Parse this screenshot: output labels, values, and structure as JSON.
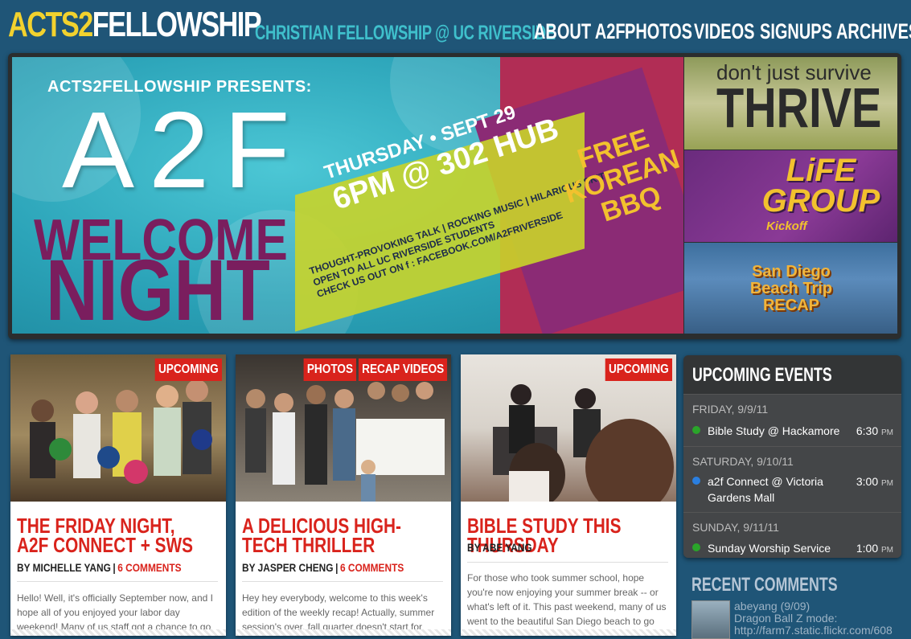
{
  "header": {
    "logo_part1": "ACTS2",
    "logo_part2": "FELLOWSHIP",
    "tagline": "CHRISTIAN FELLOWSHIP @ UC RIVERSIDE",
    "nav": [
      "ABOUT A2F",
      "PHOTOS",
      "VIDEOS",
      "SIGNUPS",
      "ARCHIVES"
    ]
  },
  "hero": {
    "presents": "ACTS2FELLOWSHIP PRESENTS:",
    "big": "A2F",
    "welcome": "WELCOME",
    "night": "NIGHT",
    "date_line1": "THURSDAY • SEPT 29",
    "date_line2": "6PM @ 302 HUB",
    "small_line1": "THOUGHT-PROVOKING TALK | ROCKING MUSIC | HILARIOUS SKIT",
    "small_line2": "OPEN TO ALL UC RIVERSIDE STUDENTS",
    "small_line3": "CHECK US OUT ON f : FACEBOOK.COM/A2FRIVERSIDE",
    "free_line1": "FREE",
    "free_line2": "KOREAN",
    "free_line3": "BBQ"
  },
  "promos": {
    "p1_small": "don't just survive",
    "p1_big": "THRIVE",
    "p2_big": "LiFE GROUP",
    "p2_small": "Kickoff",
    "p3": "San Diego Beach Trip RECAP"
  },
  "posts": [
    {
      "tags": [
        "UPCOMING"
      ],
      "title": "THE FRIDAY NIGHT, A2F CONNECT + SWS",
      "author": "BY MICHELLE YANG",
      "comments": "6 COMMENTS",
      "excerpt": "Hello!  Well, it's officially September now, and I hope all of you enjoyed your labor day weekend!  Many of us staff got a chance to go"
    },
    {
      "tags": [
        "PHOTOS",
        "RECAP",
        "VIDEOS"
      ],
      "title": "A DELICIOUS HIGH-TECH THRILLER",
      "author": "BY JASPER CHENG",
      "comments": "6 COMMENTS",
      "excerpt": "Hey hey everybody, welcome to this week's edition of the weekly recap! Actually, summer session's over, fall quarter doesn't start for"
    },
    {
      "tags": [
        "UPCOMING"
      ],
      "title": "BIBLE STUDY THIS THURSDAY",
      "author": "BY ABE YANG",
      "comments": "",
      "excerpt": "For those who took summer school, hope you're now enjoying your summer break -- or what's left of it. This past weekend, many of us went to the beautiful San Diego beach to go"
    }
  ],
  "events": {
    "title": "UPCOMING EVENTS",
    "days": [
      {
        "date": "FRIDAY, 9/9/11",
        "items": [
          {
            "name": "Bible Study @ Hackamore",
            "time": "6:30",
            "ampm": "PM",
            "color": "#2aa52a"
          }
        ]
      },
      {
        "date": "SATURDAY, 9/10/11",
        "items": [
          {
            "name": "a2f Connect @ Victoria Gardens Mall",
            "time": "3:00",
            "ampm": "PM",
            "color": "#2a7fe0"
          }
        ]
      },
      {
        "date": "SUNDAY, 9/11/11",
        "items": [
          {
            "name": "Sunday Worship Service",
            "time": "1:00",
            "ampm": "PM",
            "color": "#2aa52a"
          }
        ]
      }
    ]
  },
  "recent": {
    "title": "RECENT COMMENTS",
    "line1": "abeyang (9/09)",
    "line2": "Dragon Ball Z mode:",
    "line3": "http://farm7.static.flickr.com/608"
  },
  "colors": {
    "background": "#1f5577",
    "logo_yellow": "#f2d22e",
    "tagline_teal": "#3fc0cc",
    "post_red": "#d9231c"
  }
}
